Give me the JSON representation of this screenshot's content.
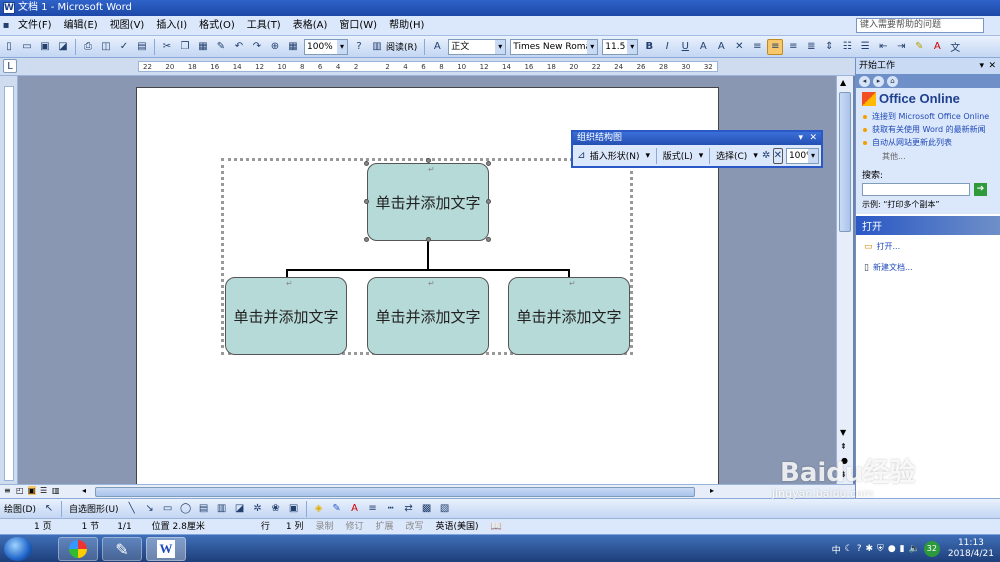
{
  "window": {
    "title": "文档 1 - Microsoft Word"
  },
  "menu": {
    "items": [
      "文件(F)",
      "编辑(E)",
      "视图(V)",
      "插入(I)",
      "格式(O)",
      "工具(T)",
      "表格(A)",
      "窗口(W)",
      "帮助(H)"
    ],
    "help_placeholder": "键入需要帮助的问题"
  },
  "toolbar": {
    "zoom": "100%",
    "read_label": "阅读(R)",
    "style": "正文",
    "font": "Times New Roman",
    "font_size": "11.5"
  },
  "ruler": {
    "ticks": [
      "22",
      "20",
      "18",
      "16",
      "14",
      "12",
      "10",
      "8",
      "6",
      "4",
      "2",
      "",
      "2",
      "4",
      "6",
      "8",
      "10",
      "12",
      "14",
      "16",
      "18",
      "20",
      "22",
      "24",
      "26",
      "28",
      "30",
      "32"
    ]
  },
  "org_chart": {
    "top_node": "单击并添加文字",
    "children": [
      "单击并添加文字",
      "单击并添加文字",
      "单击并添加文字"
    ]
  },
  "org_toolbar": {
    "title": "组织结构图",
    "insert_shape": "插入形状(N)",
    "layout": "版式(L)",
    "select": "选择(C)",
    "zoom": "100%"
  },
  "task_pane": {
    "title": "开始工作",
    "office_online": "Office Online",
    "links": [
      "连接到 Microsoft Office Online",
      "获取有关使用 Word 的最新新闻",
      "自动从网站更新此列表"
    ],
    "more": "其他...",
    "search_label": "搜索:",
    "example": "示例: “打印多个副本”",
    "open_section": "打开",
    "open_link": "打开...",
    "new_doc": "新建文档..."
  },
  "drawing_toolbar": {
    "draw": "绘图(D)",
    "autoshapes": "自选图形(U)"
  },
  "status_bar": {
    "page": "1 页",
    "section": "1 节",
    "pages": "1/1",
    "position": "位置 2.8厘米",
    "line": "行",
    "col": "1 列",
    "rec": "录制",
    "trk": "修订",
    "ext": "扩展",
    "ovr": "改写",
    "lang": "英语(美国)"
  },
  "taskbar": {
    "time": "11:13",
    "date": "2018/4/21",
    "ime": "中",
    "badge": "32"
  },
  "watermark": {
    "brand": "Baidu经验",
    "url": "jingyan.baidu.com"
  },
  "colors": {
    "node_fill": "#b6dad8",
    "title_blue": "#2a58c6"
  }
}
